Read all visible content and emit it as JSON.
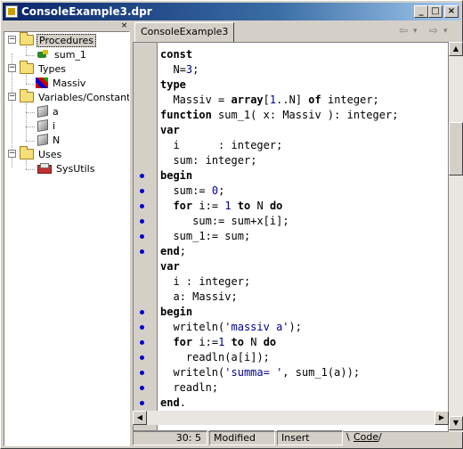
{
  "window": {
    "title": "ConsoleExample3.dpr",
    "buttons": [
      "_",
      "□",
      "×"
    ]
  },
  "tree": {
    "close_glyph": "×",
    "nodes": [
      {
        "label": "Procedures",
        "icon": "folder-icon",
        "expander": "−",
        "selected": true
      },
      {
        "label": "sum_1",
        "icon": "procedure-icon"
      },
      {
        "label": "Types",
        "icon": "folder-icon",
        "expander": "−"
      },
      {
        "label": "Massiv",
        "icon": "type-icon"
      },
      {
        "label": "Variables/Constants",
        "icon": "folder-icon",
        "expander": "−"
      },
      {
        "label": "a",
        "icon": "variable-icon"
      },
      {
        "label": "i",
        "icon": "variable-icon"
      },
      {
        "label": "N",
        "icon": "variable-icon"
      },
      {
        "label": "Uses",
        "icon": "folder-icon",
        "expander": "−"
      },
      {
        "label": "SysUtils",
        "icon": "unit-icon"
      }
    ]
  },
  "editor": {
    "tab": "ConsoleExample3",
    "nav_back": "⇦",
    "nav_back_drop": "▾",
    "nav_fwd": "⇨",
    "nav_fwd_drop": "▾",
    "code_lines": [
      "const",
      "  N=3;",
      "type",
      "  Massiv = array[1..N] of integer;",
      "function sum_1( x: Massiv ): integer;",
      "var",
      "  i      : integer;",
      "  sum: integer;",
      "begin",
      "  sum:= 0;",
      "  for i:= 1 to N do",
      "     sum:= sum+x[i];",
      "  sum_1:= sum;",
      "end;",
      "var",
      "  i : integer;",
      "  a: Massiv;",
      "begin",
      "  writeln('massiv a');",
      "  for i:=1 to N do",
      "    readln(a[i]);",
      "  writeln('summa= ', sum_1(a));",
      "  readln;",
      "end."
    ],
    "breakpoint_lines": [
      9,
      10,
      11,
      12,
      13,
      14,
      18,
      19,
      20,
      21,
      22,
      23,
      24
    ],
    "scroll_up": "▲",
    "scroll_down": "▼",
    "scroll_left": "◀",
    "scroll_right": "▶"
  },
  "status": {
    "position": "30:  5",
    "modified": "Modified",
    "insert": "Insert",
    "code_tab": "Code"
  }
}
